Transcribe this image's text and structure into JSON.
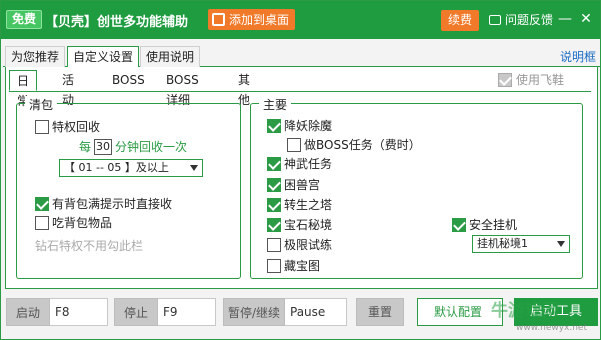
{
  "titlebar": {
    "free_badge": "免费",
    "title": "【贝壳】创世多功能辅助",
    "add_desktop": "添加到桌面",
    "renew": "续费",
    "feedback": "问题反馈",
    "minimize": "—",
    "close": "✕"
  },
  "main_tabs": [
    "为您推荐",
    "自定义设置",
    "使用说明"
  ],
  "help_link": "说明框",
  "sub_tabs": [
    "日常",
    "活动",
    "BOSS",
    "BOSS详细",
    "其他"
  ],
  "use_flying_shoes": {
    "label": "使用飞鞋",
    "checked": true,
    "disabled": true
  },
  "cleanup": {
    "title": "清包",
    "privilege_recycle": {
      "label": "特权回收",
      "checked": false
    },
    "every_prefix": "每",
    "minutes": "30",
    "every_suffix": "分钟回收一次",
    "level_select": "【 01 -- 05 】及以上",
    "full_bag_recycle": {
      "label": "有背包满提示时直接收",
      "checked": true
    },
    "eat_bag_items": {
      "label": "吃背包物品",
      "checked": false
    },
    "hint": "钻石特权不用勾此栏"
  },
  "primary": {
    "title": "主要",
    "items": [
      {
        "label": "降妖除魔",
        "checked": true
      },
      {
        "label": "做BOSS任务（费时）",
        "checked": false
      },
      {
        "label": "神武任务",
        "checked": true
      },
      {
        "label": "困兽宫",
        "checked": true
      },
      {
        "label": "转生之塔",
        "checked": true
      },
      {
        "label": "宝石秘境",
        "checked": true
      },
      {
        "label": "极限试练",
        "checked": false
      },
      {
        "label": "藏宝图",
        "checked": false
      }
    ],
    "safe_hangup": {
      "label": "安全挂机",
      "checked": true
    },
    "hangup_select": "挂机秘境1"
  },
  "bottom": {
    "start_label": "启动",
    "start_key": "F8",
    "stop_label": "停止",
    "stop_key": "F9",
    "pause_label": "暂停/继续",
    "pause_key": "Pause",
    "reset": "重置",
    "default": "默认配置",
    "start_tool": "启动工具"
  },
  "watermark": {
    "logo": "牛游戏网",
    "url": "www.newyx.net"
  },
  "colors": {
    "accent": "#1f9b40",
    "orange": "#f07a2a"
  }
}
